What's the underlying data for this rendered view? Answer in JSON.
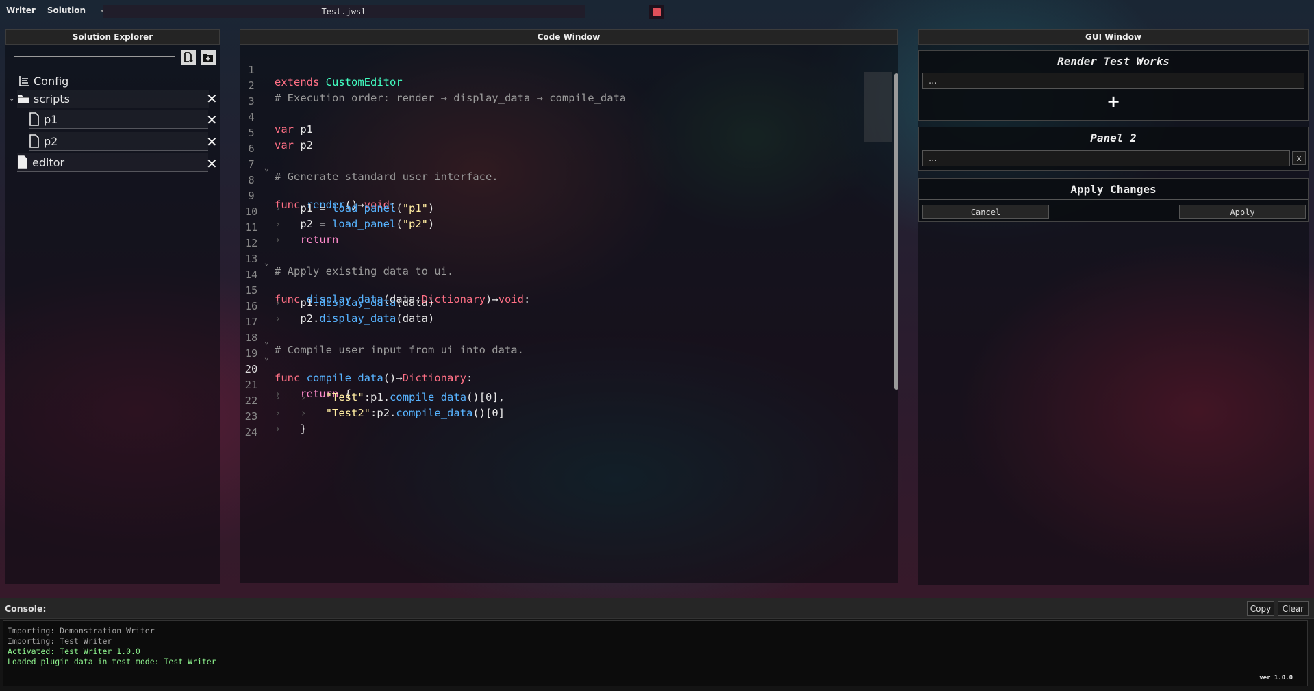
{
  "menubar": {
    "items": [
      "Writer",
      "Solution"
    ],
    "file_title": "Test.jwsl"
  },
  "explorer": {
    "title": "Solution Explorer",
    "items": [
      {
        "label": "Config",
        "icon": "list-icon"
      },
      {
        "label": "scripts",
        "icon": "folder-icon"
      },
      {
        "label": "p1",
        "icon": "file-icon"
      },
      {
        "label": "p2",
        "icon": "file-icon"
      },
      {
        "label": "editor",
        "icon": "file-icon"
      }
    ]
  },
  "code_window": {
    "title": "Code Window",
    "line_numbers": [
      "1",
      "2",
      "3",
      "4",
      "5",
      "6",
      "7",
      "8",
      "9",
      "10",
      "11",
      "12",
      "13",
      "14",
      "15",
      "16",
      "17",
      "18",
      "19",
      "20",
      "21",
      "22",
      "23",
      "24"
    ],
    "t": {
      "extends": "extends",
      "custom_editor": "CustomEditor",
      "comment_exec": "# Execution order: render → display_data → compile_data",
      "var": "var",
      "p1": "p1",
      "p2": "p2",
      "comment_generate": "# Generate standard user interface.",
      "func": "func",
      "render": "render",
      "parens": "()",
      "arrow": "→",
      "void": "void",
      "colon": ":",
      "eq": " = ",
      "load_panel": "load_panel",
      "open": "(",
      "close": ")",
      "str_p1": "\"p1\"",
      "str_p2": "\"p2\"",
      "return": "return",
      "comment_apply": "# Apply existing data to ui.",
      "display_data": "display_data",
      "data": "data",
      "dictionary": "Dictionary",
      "dot": ".",
      "comment_compile": "# Compile user input from ui into data.",
      "compile_data": "compile_data",
      "brace_open": " {",
      "str_test": "\"Test\"",
      "str_test2": "\"Test2\"",
      "index0": "[0]",
      "comma": ",",
      "brace_close": "}"
    }
  },
  "gui_window": {
    "title": "GUI Window",
    "panel1_title": "Render Test Works",
    "panel1_input": "...",
    "panel2_title": "Panel 2",
    "panel2_input": "...",
    "x_label": "x",
    "apply_title": "Apply Changes",
    "cancel_label": "Cancel",
    "apply_label": "Apply"
  },
  "console": {
    "title": "Console:",
    "copy_label": "Copy",
    "clear_label": "Clear",
    "logs": [
      {
        "text": "Importing: Demonstration Writer",
        "level": "info"
      },
      {
        "text": "Importing: Test Writer",
        "level": "info"
      },
      {
        "text": "Activated: Test Writer 1.0.0",
        "level": "success"
      },
      {
        "text": "Loaded plugin data in test mode: Test Writer",
        "level": "success"
      }
    ],
    "version": "ver 1.0.0"
  },
  "colors": {
    "keyword": "#ff7085",
    "type": "#42ffc2",
    "function": "#57b3ff",
    "string": "#ffeca1",
    "comment": "#9a9a9a",
    "log_info": "#a5a5a5",
    "log_success": "#8ef38e",
    "stop_button": "#e0505a"
  }
}
